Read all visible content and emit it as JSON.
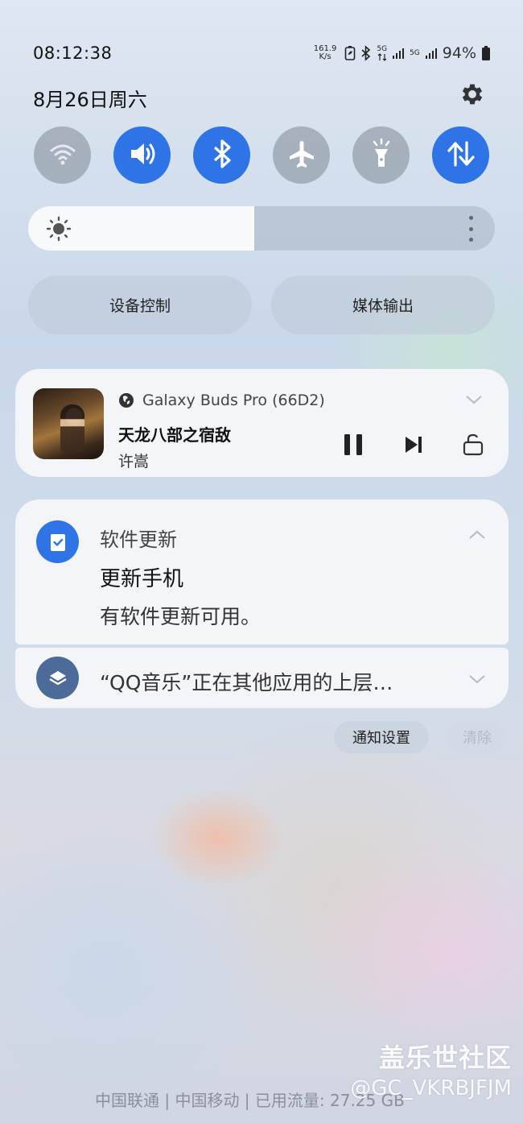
{
  "status_bar": {
    "time": "08:12:38",
    "net_speed_value": "161.9",
    "net_speed_unit": "K/s",
    "sim1_label": "5G",
    "sim2_label": "5G",
    "battery": "94%"
  },
  "date_row": {
    "date": "8月26日周六"
  },
  "quick_toggles": [
    {
      "name": "wifi",
      "state": "off"
    },
    {
      "name": "sound",
      "state": "on"
    },
    {
      "name": "bluetooth",
      "state": "on"
    },
    {
      "name": "airplane-mode",
      "state": "off"
    },
    {
      "name": "flashlight",
      "state": "off"
    },
    {
      "name": "mobile-data",
      "state": "on"
    }
  ],
  "brightness": {
    "level": 0.485
  },
  "pills": {
    "device_control": "设备控制",
    "media_output": "媒体输出"
  },
  "media": {
    "output_device": "Galaxy Buds Pro (66D2)",
    "song": "天龙八部之宿敌",
    "artist": "许嵩"
  },
  "notification": {
    "app": "软件更新",
    "title": "更新手机",
    "body": "有软件更新可用。"
  },
  "notification2": {
    "text": "“QQ音乐”正在其他应用的上层…"
  },
  "actions": {
    "settings": "通知设置",
    "clear": "清除"
  },
  "footer": {
    "carrier": "中国联通 | 中国移动 | 已用流量: 27.25 GB"
  },
  "watermark": {
    "line1": "盖乐世社区",
    "line2": "@GC_VKRBJFJM"
  },
  "colors": {
    "accent": "#2f74e7",
    "toggle_off": "#969fac",
    "card_bg": "#f5f7fa"
  }
}
